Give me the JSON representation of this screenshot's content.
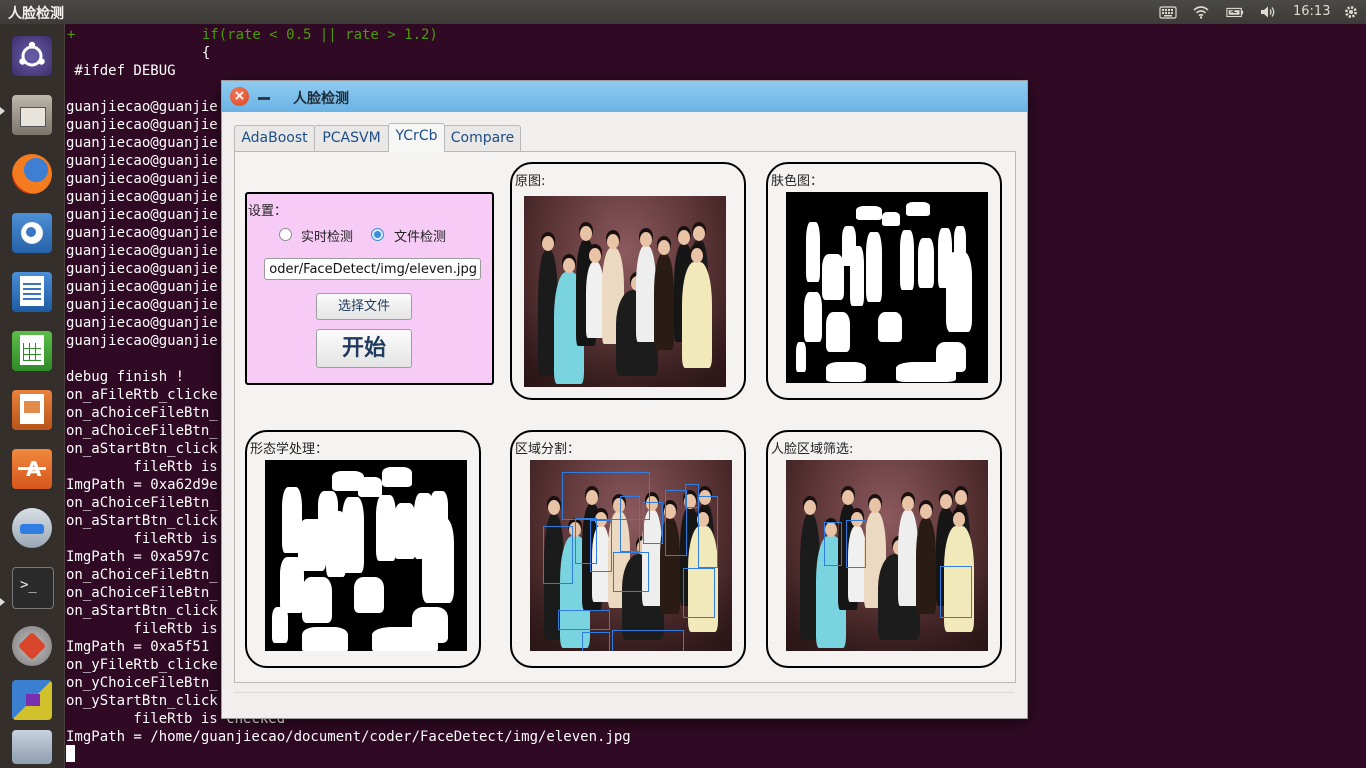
{
  "top_panel": {
    "title": "人脸检测",
    "clock": "16:13",
    "tray_icons": [
      "keyboard-icon",
      "wifi-icon",
      "battery-icon",
      "volume-icon",
      "gear-icon"
    ]
  },
  "launcher": {
    "items": [
      "ubuntu-dash-icon",
      "files-icon",
      "firefox-icon",
      "chromium-icon",
      "writer-icon",
      "calc-icon",
      "impress-icon",
      "software-center-icon",
      "update-manager-icon",
      "terminal-icon",
      "system-settings-icon",
      "workspace-switcher-icon",
      "trash-icon"
    ]
  },
  "terminal": {
    "lines": [
      "+               if(rate < 0.5 || rate > 1.2)",
      "                {",
      " #ifdef DEBUG",
      "",
      "guanjiecao@guanjie",
      "guanjiecao@guanjie",
      "guanjiecao@guanjie",
      "guanjiecao@guanjie",
      "guanjiecao@guanjie",
      "guanjiecao@guanjie",
      "guanjiecao@guanjie",
      "guanjiecao@guanjie",
      "guanjiecao@guanjie",
      "guanjiecao@guanjie",
      "guanjiecao@guanjie",
      "guanjiecao@guanjie",
      "guanjiecao@guanjie",
      "guanjiecao@guanjie",
      "debug finish !",
      "on_aFileRtb_clicke",
      "on_aChoiceFileBtn_",
      "on_aChoiceFileBtn_",
      "on_aStartBtn_click",
      "        fileRtb is",
      "ImgPath = 0xa62d9e",
      "on_aChoiceFileBtn_",
      "on_aStartBtn_click",
      "        fileRtb is",
      "ImgPath = 0xa597c",
      "on_aChoiceFileBtn_",
      "on_aChoiceFileBtn_",
      "on_aStartBtn_click",
      "        fileRtb is",
      "ImgPath = 0xa5f51",
      "on_yFileRtb_clicke",
      "on_yChoiceFileBtn_",
      "on_yStartBtn_click",
      "        fileRtb is checked",
      "ImgPath = /home/guanjiecao/document/coder/FaceDetect/img/eleven.jpg"
    ]
  },
  "dialog": {
    "title": "人脸检测",
    "tabs": [
      {
        "label": "AdaBoost"
      },
      {
        "label": "PCASVM"
      },
      {
        "label": "YCrCb"
      },
      {
        "label": "Compare"
      }
    ],
    "active_tab": "YCrCb",
    "settings": {
      "title": "设置：",
      "radio_realtime": "实时检测",
      "radio_file": "文件检测",
      "selected_mode": "文件检测",
      "path_value": "/home/guanjiecao/document/coder/FaceDetect/img/eleven.jpg",
      "path_visible": "oder/FaceDetect/img/eleven.jpg",
      "choose_file_label": "选择文件",
      "start_label": "开始"
    },
    "panels": {
      "original": "原图:",
      "skin": "肤色图：",
      "morphology": "形态学处理：",
      "segmentation": "区域分割：",
      "face_filter": "人脸区域筛选:"
    }
  },
  "colors": {
    "terminal_bg": "#300a24",
    "settings_bg": "#f6ccf6",
    "titlebar": "#6bb3e6",
    "detection_box": "#2f7de1"
  }
}
